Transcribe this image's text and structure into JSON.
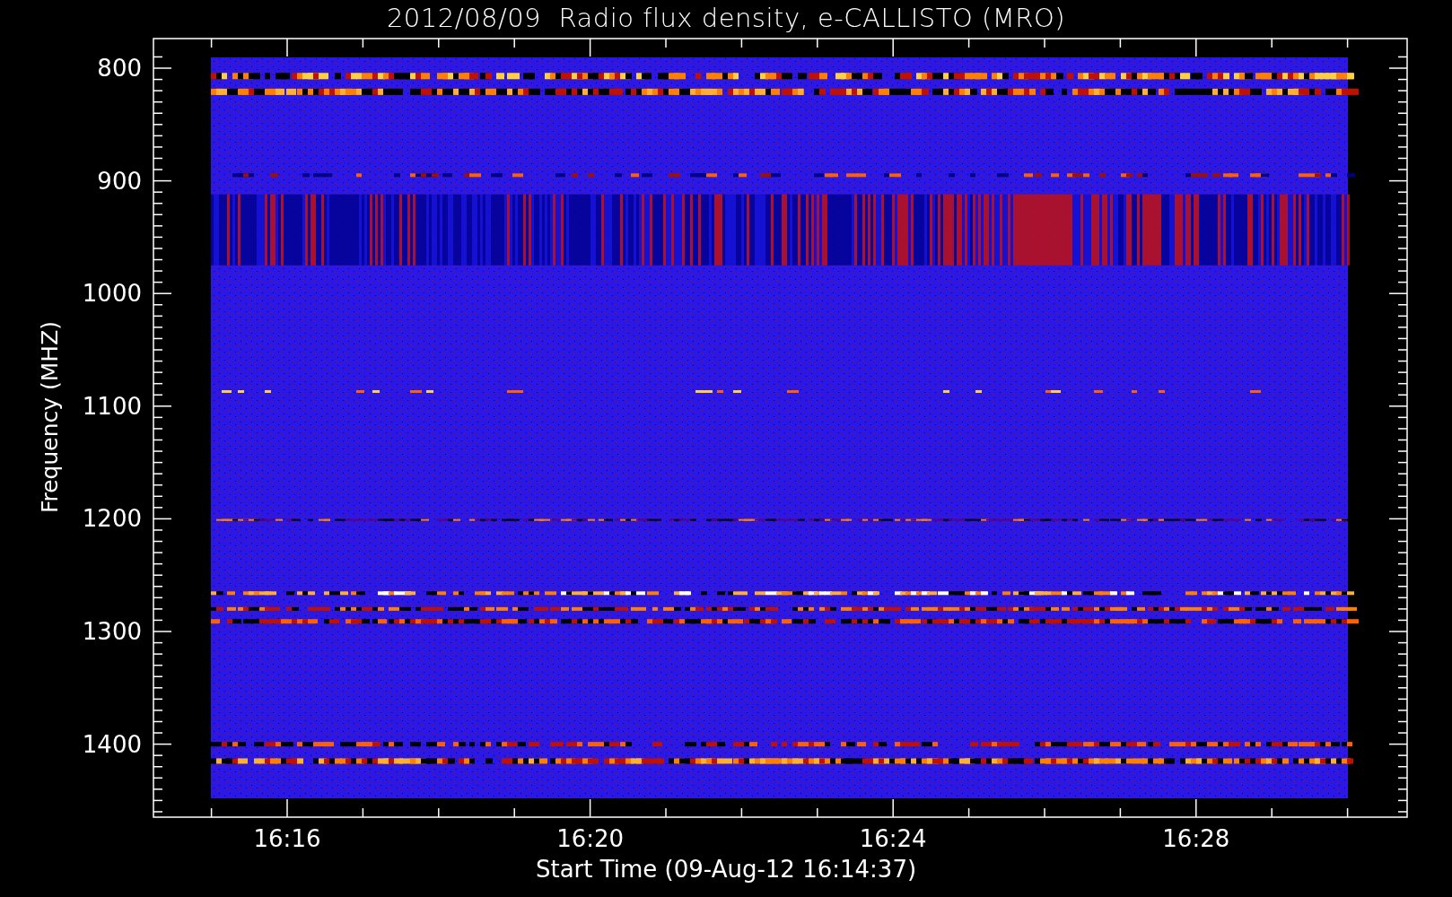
{
  "title": "2012/08/09  Radio flux density, e-CALLISTO (MRO)",
  "chart": {
    "ylabel": "Frequency (MHZ)",
    "xlabel": "Start Time (09-Aug-12 16:14:37)",
    "yticks": [
      "800",
      "900",
      "1000",
      "1100",
      "1200",
      "1300",
      "1400"
    ],
    "xticks": [
      "16:16",
      "16:20",
      "16:24",
      "16:28"
    ]
  }
}
